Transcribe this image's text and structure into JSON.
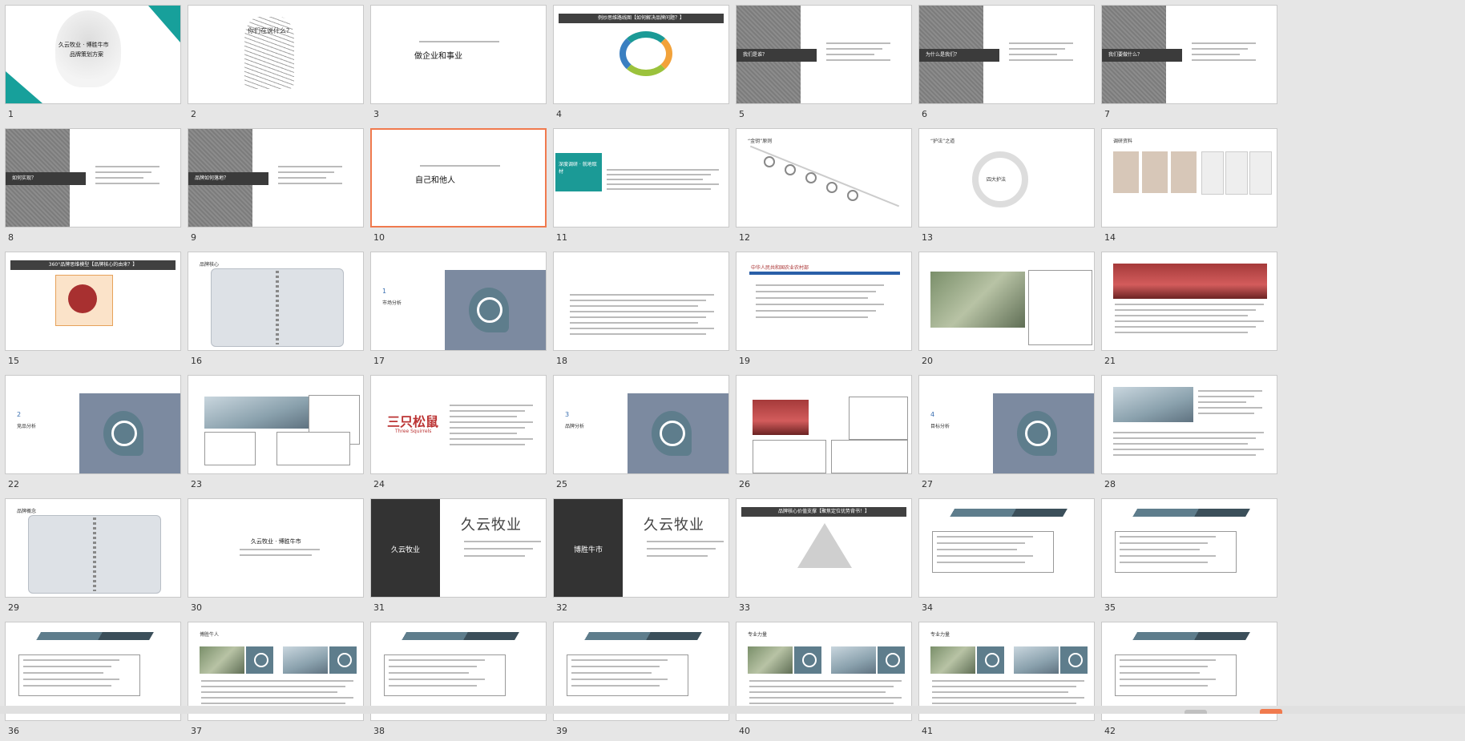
{
  "slides": [
    {
      "n": "1",
      "type": "cover",
      "title": "久云牧业 · 博胜牛市",
      "subtitle": "品牌策划方案"
    },
    {
      "n": "2",
      "type": "sketch",
      "title": "你们在说什么？"
    },
    {
      "n": "3",
      "type": "quote",
      "top": "",
      "main": "做企业和事业"
    },
    {
      "n": "4",
      "type": "bar",
      "title": "例炒思维路线图【如何解决品牌问题？】"
    },
    {
      "n": "5",
      "type": "greyside",
      "title": "我们是谁？"
    },
    {
      "n": "6",
      "type": "greyside",
      "title": "为什么是我们？"
    },
    {
      "n": "7",
      "type": "greyside",
      "title": "我们要做什么？"
    },
    {
      "n": "8",
      "type": "greyside",
      "title": "如何实现？"
    },
    {
      "n": "9",
      "type": "greyside",
      "title": "品牌如何落地？"
    },
    {
      "n": "10",
      "type": "quote",
      "top": "",
      "main": "自己和他人"
    },
    {
      "n": "11",
      "type": "teal",
      "title": "深度调研 · 就地取材"
    },
    {
      "n": "12",
      "type": "line",
      "title": "“金钥”原则"
    },
    {
      "n": "13",
      "type": "cycle",
      "title": "“护法”之道",
      "center": "四大护法"
    },
    {
      "n": "14",
      "type": "docs",
      "title": "调研资料"
    },
    {
      "n": "15",
      "type": "bar",
      "title": "360°品牌思维模型【品牌核心的由来？】"
    },
    {
      "n": "16",
      "type": "notebook",
      "title": "品牌核心"
    },
    {
      "n": "17",
      "type": "section",
      "title": "市场分析",
      "index": "1"
    },
    {
      "n": "18",
      "type": "article",
      "title": ""
    },
    {
      "n": "19",
      "type": "govsite",
      "title": "中华人民共和国农业农村部"
    },
    {
      "n": "20",
      "type": "photo",
      "title": ""
    },
    {
      "n": "21",
      "type": "photo3",
      "title": ""
    },
    {
      "n": "22",
      "type": "section",
      "title": "竞品分析",
      "index": "2"
    },
    {
      "n": "23",
      "type": "photoboxes",
      "title": ""
    },
    {
      "n": "24",
      "type": "logo",
      "title": "三只松鼠",
      "logo": "三只松鼠",
      "logo_en": "Three Squirrels"
    },
    {
      "n": "25",
      "type": "section",
      "title": "品牌分析",
      "index": "3"
    },
    {
      "n": "26",
      "type": "product",
      "title": ""
    },
    {
      "n": "27",
      "type": "section",
      "title": "目标分析",
      "index": "4"
    },
    {
      "n": "28",
      "type": "photo2",
      "title": ""
    },
    {
      "n": "29",
      "type": "notebook",
      "title": "品牌概念"
    },
    {
      "n": "30",
      "type": "text",
      "title": "久云牧业 · 博胜牛市"
    },
    {
      "n": "31",
      "type": "brand",
      "left": "久云牧业",
      "brand": "久云牧业"
    },
    {
      "n": "32",
      "type": "brand",
      "left": "博胜牛市",
      "brand": "久云牧业"
    },
    {
      "n": "33",
      "type": "triangle",
      "title": "品牌核心价值支撑【聚焦定位优势背书！】"
    },
    {
      "n": "34",
      "type": "arrow",
      "title": ""
    },
    {
      "n": "35",
      "type": "arrow",
      "title": ""
    },
    {
      "n": "36",
      "type": "arrow",
      "title": ""
    },
    {
      "n": "37",
      "type": "people",
      "title": "博胜牛人"
    },
    {
      "n": "38",
      "type": "arrow",
      "title": ""
    },
    {
      "n": "39",
      "type": "arrow",
      "title": ""
    },
    {
      "n": "40",
      "type": "people",
      "title": "专业力量"
    },
    {
      "n": "41",
      "type": "people",
      "title": "专业力量"
    },
    {
      "n": "42",
      "type": "arrow",
      "title": ""
    }
  ],
  "selected": "10",
  "colors": {
    "accent": "#f07a4e",
    "teal": "#17a09b",
    "slate": "#5e7d8c"
  }
}
